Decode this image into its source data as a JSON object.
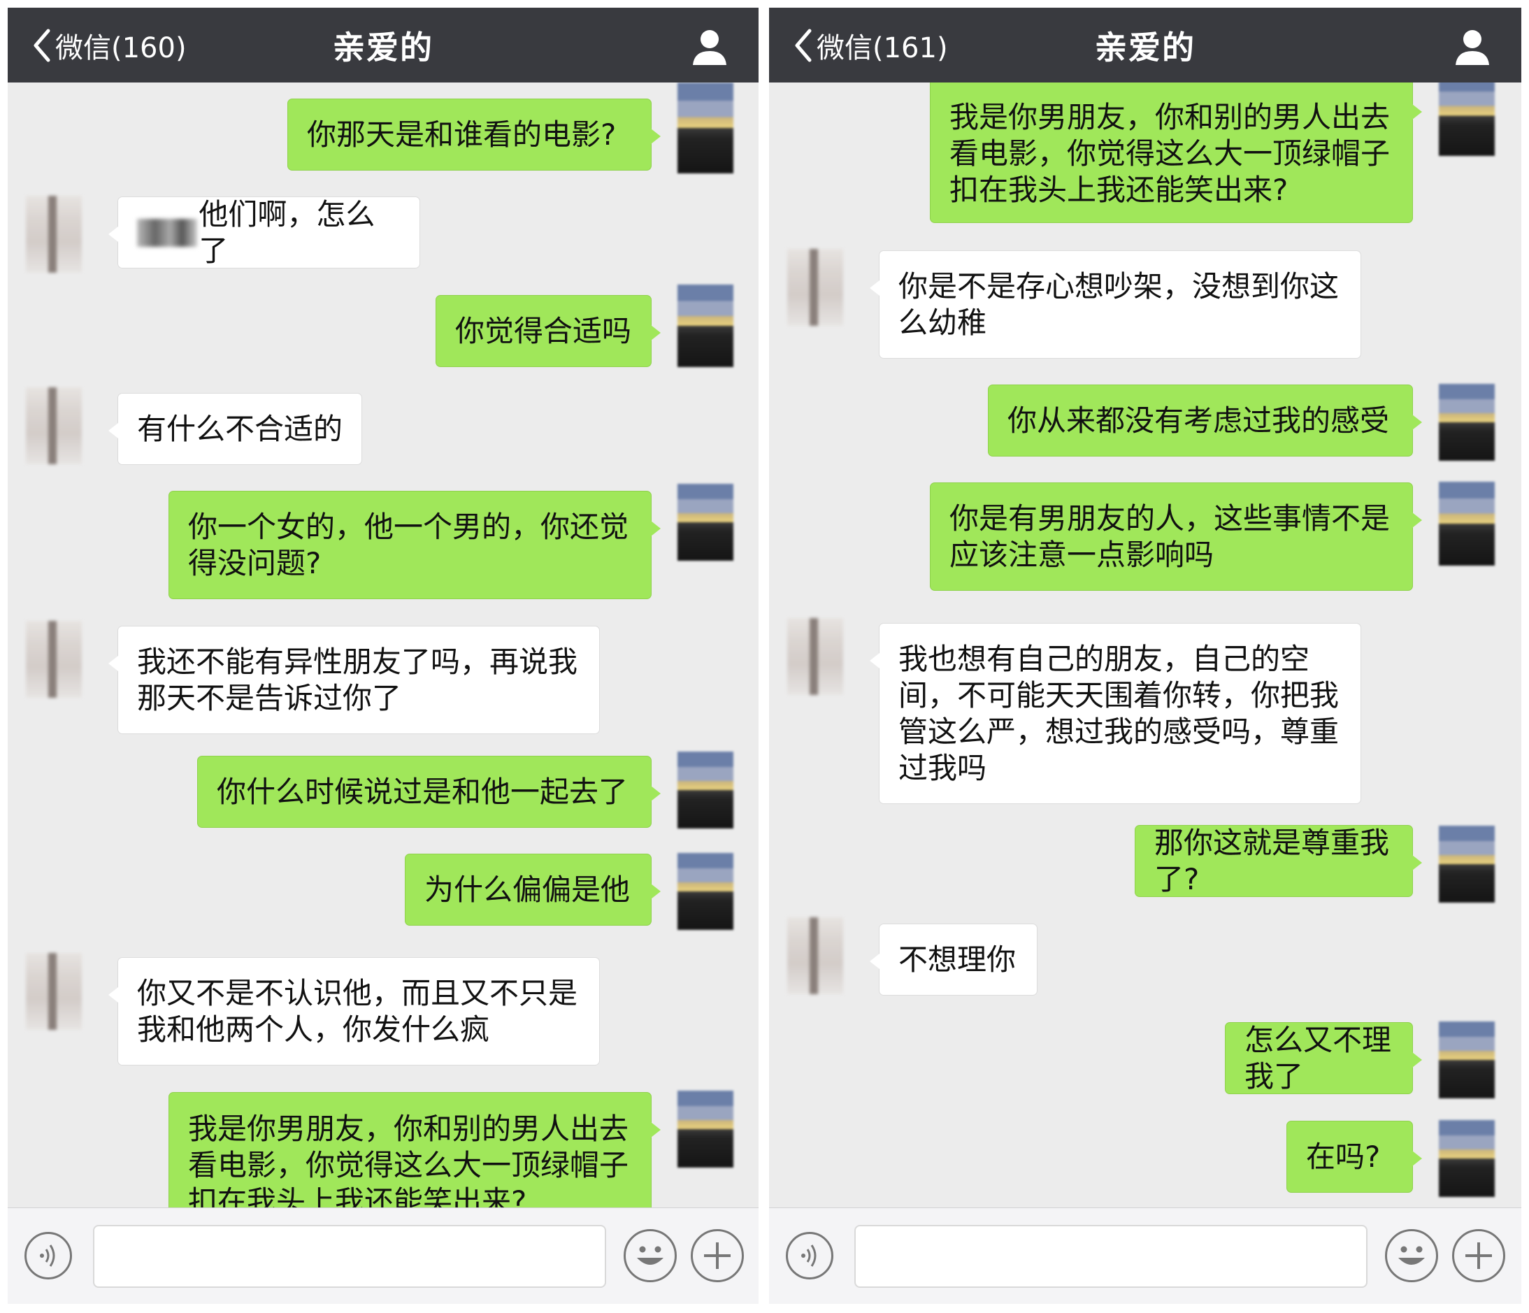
{
  "left": {
    "header": {
      "back_label": "微信(160)",
      "title": "亲爱的"
    },
    "messages": [
      {
        "from": "me",
        "text": "你那天是和谁看的电影?"
      },
      {
        "from": "other",
        "text": "他们啊，怎么了"
      },
      {
        "from": "me",
        "text": "你觉得合适吗"
      },
      {
        "from": "other",
        "text": "有什么不合适的"
      },
      {
        "from": "me",
        "text": "你一个女的，他一个男的，你还觉\n得没问题?"
      },
      {
        "from": "other",
        "text": "我还不能有异性朋友了吗，再说我\n那天不是告诉过你了"
      },
      {
        "from": "me",
        "text": "你什么时候说过是和他一起去了"
      },
      {
        "from": "me",
        "text": "为什么偏偏是他"
      },
      {
        "from": "other",
        "text": "你又不是不认识他，而且又不只是\n我和他两个人，你发什么疯"
      },
      {
        "from": "me",
        "text": "我是你男朋友，你和别的男人出去\n看电影，你觉得这么大一顶绿帽子\n扣在我头上我还能笑出来?"
      }
    ]
  },
  "right": {
    "header": {
      "back_label": "微信(161)",
      "title": "亲爱的"
    },
    "messages": [
      {
        "from": "me",
        "text": "我是你男朋友，你和别的男人出去\n看电影，你觉得这么大一顶绿帽子\n扣在我头上我还能笑出来?"
      },
      {
        "from": "other",
        "text": "你是不是存心想吵架，没想到你这\n么幼稚"
      },
      {
        "from": "me",
        "text": "你从来都没有考虑过我的感受"
      },
      {
        "from": "me",
        "text": "你是有男朋友的人，这些事情不是\n应该注意一点影响吗"
      },
      {
        "from": "other",
        "text": "我也想有自己的朋友，自己的空\n间，不可能天天围着你转，你把我\n管这么严，想过我的感受吗，尊重\n过我吗"
      },
      {
        "from": "me",
        "text": "那你这就是尊重我了?"
      },
      {
        "from": "other",
        "text": "不想理你"
      },
      {
        "from": "me",
        "text": "怎么又不理我了"
      },
      {
        "from": "me",
        "text": "在吗?"
      }
    ]
  },
  "icons": {
    "back": "chevron-left-icon",
    "profile": "person-icon",
    "voice": "voice-icon",
    "emoji": "emoji-icon",
    "plus": "plus-icon"
  },
  "colors": {
    "header_bg": "#393a3f",
    "chat_bg": "#ececec",
    "my_bubble": "#a0e75a",
    "their_bubble": "#ffffff"
  }
}
